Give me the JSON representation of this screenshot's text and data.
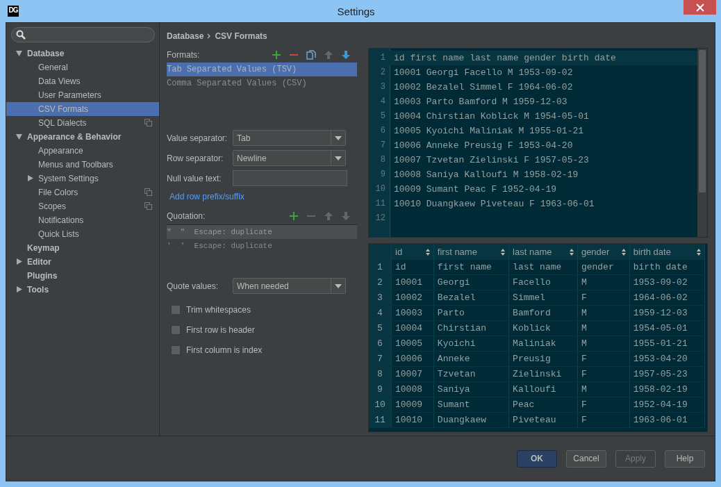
{
  "window": {
    "logo": "DG",
    "title": "Settings"
  },
  "sidebar": {
    "items": [
      {
        "label": "Database",
        "expanded": true,
        "selected": false,
        "children": [
          {
            "label": "General",
            "selected": false
          },
          {
            "label": "Data Views",
            "selected": false
          },
          {
            "label": "User Parameters",
            "selected": false
          },
          {
            "label": "CSV Formats",
            "selected": true
          },
          {
            "label": "SQL Dialects",
            "selected": false,
            "project_icon": true
          }
        ]
      },
      {
        "label": "Appearance & Behavior",
        "expanded": true,
        "selected": false,
        "children": [
          {
            "label": "Appearance",
            "selected": false
          },
          {
            "label": "Menus and Toolbars",
            "selected": false
          },
          {
            "label": "System Settings",
            "selected": false,
            "expanded": false
          },
          {
            "label": "File Colors",
            "selected": false,
            "project_icon": true
          },
          {
            "label": "Scopes",
            "selected": false,
            "project_icon": true
          },
          {
            "label": "Notifications",
            "selected": false
          },
          {
            "label": "Quick Lists",
            "selected": false
          }
        ]
      },
      {
        "label": "Keymap",
        "selected": false
      },
      {
        "label": "Editor",
        "selected": false,
        "expanded": false
      },
      {
        "label": "Plugins",
        "selected": false
      },
      {
        "label": "Tools",
        "selected": false,
        "expanded": false
      }
    ]
  },
  "breadcrumb": [
    "Database",
    "CSV Formats"
  ],
  "formats": {
    "label": "Formats:",
    "toolbar": [
      {
        "kind": "add",
        "disabled": false
      },
      {
        "kind": "remove",
        "disabled": false
      },
      {
        "kind": "copy",
        "disabled": false
      },
      {
        "kind": "up",
        "disabled": true
      },
      {
        "kind": "down",
        "disabled": false
      }
    ],
    "items": [
      {
        "label": "Tab Separated Values (TSV)",
        "selected": true
      },
      {
        "label": "Comma Separated Values (CSV)",
        "selected": false
      }
    ]
  },
  "fields": [
    {
      "kind": "select",
      "label": "Value separator:",
      "value": "Tab"
    },
    {
      "kind": "select",
      "label": "Row separator:",
      "value": "Newline"
    },
    {
      "kind": "input",
      "label": "Null value text:"
    }
  ],
  "link": "Add row prefix/suffix",
  "quotation": {
    "label": "Quotation:",
    "toolbar": [
      {
        "kind": "add",
        "disabled": false
      },
      {
        "kind": "remove",
        "disabled": true
      },
      {
        "kind": "up",
        "disabled": true
      },
      {
        "kind": "down",
        "disabled": true
      }
    ],
    "items": [
      {
        "quotes": "\"  \"",
        "escape": "Escape: duplicate",
        "selected": true
      },
      {
        "quotes": "'  '",
        "escape": "Escape: duplicate",
        "selected": false
      }
    ]
  },
  "quote_values": {
    "label": "Quote values:",
    "value": "When needed"
  },
  "checkboxes": [
    {
      "label": "Trim whitespaces",
      "checked": false
    },
    {
      "label": "First row is header",
      "checked": false
    },
    {
      "label": "First column is index",
      "checked": false
    }
  ],
  "editor": {
    "lines": [
      {
        "number": "1",
        "text": "id first name last name gender birth date",
        "current": true
      },
      {
        "number": "2",
        "text": "10001 Georgi Facello M 1953-09-02",
        "current": false
      },
      {
        "number": "3",
        "text": "10002 Bezalel Simmel F 1964-06-02",
        "current": false
      },
      {
        "number": "4",
        "text": "10003 Parto Bamford M 1959-12-03",
        "current": false
      },
      {
        "number": "5",
        "text": "10004 Chirstian Koblick M 1954-05-01",
        "current": false
      },
      {
        "number": "6",
        "text": "10005 Kyoichi Maliniak M 1955-01-21",
        "current": false
      },
      {
        "number": "7",
        "text": "10006 Anneke Preusig F 1953-04-20",
        "current": false
      },
      {
        "number": "8",
        "text": "10007 Tzvetan Zielinski F 1957-05-23",
        "current": false
      },
      {
        "number": "9",
        "text": "10008 Saniya Kalloufi M 1958-02-19",
        "current": false
      },
      {
        "number": "10",
        "text": "10009 Sumant Peac F 1952-04-19",
        "current": false
      },
      {
        "number": "11",
        "text": "10010 Duangkaew Piveteau F 1963-06-01",
        "current": false
      },
      {
        "number": "12",
        "current": false
      }
    ]
  },
  "table": {
    "columns": [
      "id",
      "first name",
      "last name",
      "gender",
      "birth date"
    ],
    "rows": [
      {
        "number": "1",
        "cells": [
          "id",
          "first name",
          "last name",
          "gender",
          "birth date"
        ]
      },
      {
        "number": "2",
        "cells": [
          "10001",
          "Georgi",
          "Facello",
          "M",
          "1953-09-02"
        ]
      },
      {
        "number": "3",
        "cells": [
          "10002",
          "Bezalel",
          "Simmel",
          "F",
          "1964-06-02"
        ]
      },
      {
        "number": "4",
        "cells": [
          "10003",
          "Parto",
          "Bamford",
          "M",
          "1959-12-03"
        ]
      },
      {
        "number": "5",
        "cells": [
          "10004",
          "Chirstian",
          "Koblick",
          "M",
          "1954-05-01"
        ]
      },
      {
        "number": "6",
        "cells": [
          "10005",
          "Kyoichi",
          "Maliniak",
          "M",
          "1955-01-21"
        ]
      },
      {
        "number": "7",
        "cells": [
          "10006",
          "Anneke",
          "Preusig",
          "F",
          "1953-04-20"
        ]
      },
      {
        "number": "8",
        "cells": [
          "10007",
          "Tzvetan",
          "Zielinski",
          "F",
          "1957-05-23"
        ]
      },
      {
        "number": "9",
        "cells": [
          "10008",
          "Saniya",
          "Kalloufi",
          "M",
          "1958-02-19"
        ]
      },
      {
        "number": "10",
        "cells": [
          "10009",
          "Sumant",
          "Peac",
          "F",
          "1952-04-19"
        ]
      },
      {
        "number": "11",
        "cells": [
          "10010",
          "Duangkaew",
          "Piveteau",
          "F",
          "1963-06-01"
        ]
      }
    ]
  },
  "buttons": [
    {
      "label": "OK",
      "kind": "primary",
      "disabled": false
    },
    {
      "label": "Cancel",
      "kind": "normal",
      "disabled": false
    },
    {
      "label": "Apply",
      "kind": "normal",
      "disabled": true
    },
    {
      "label": "Help",
      "kind": "normal",
      "disabled": false
    }
  ]
}
